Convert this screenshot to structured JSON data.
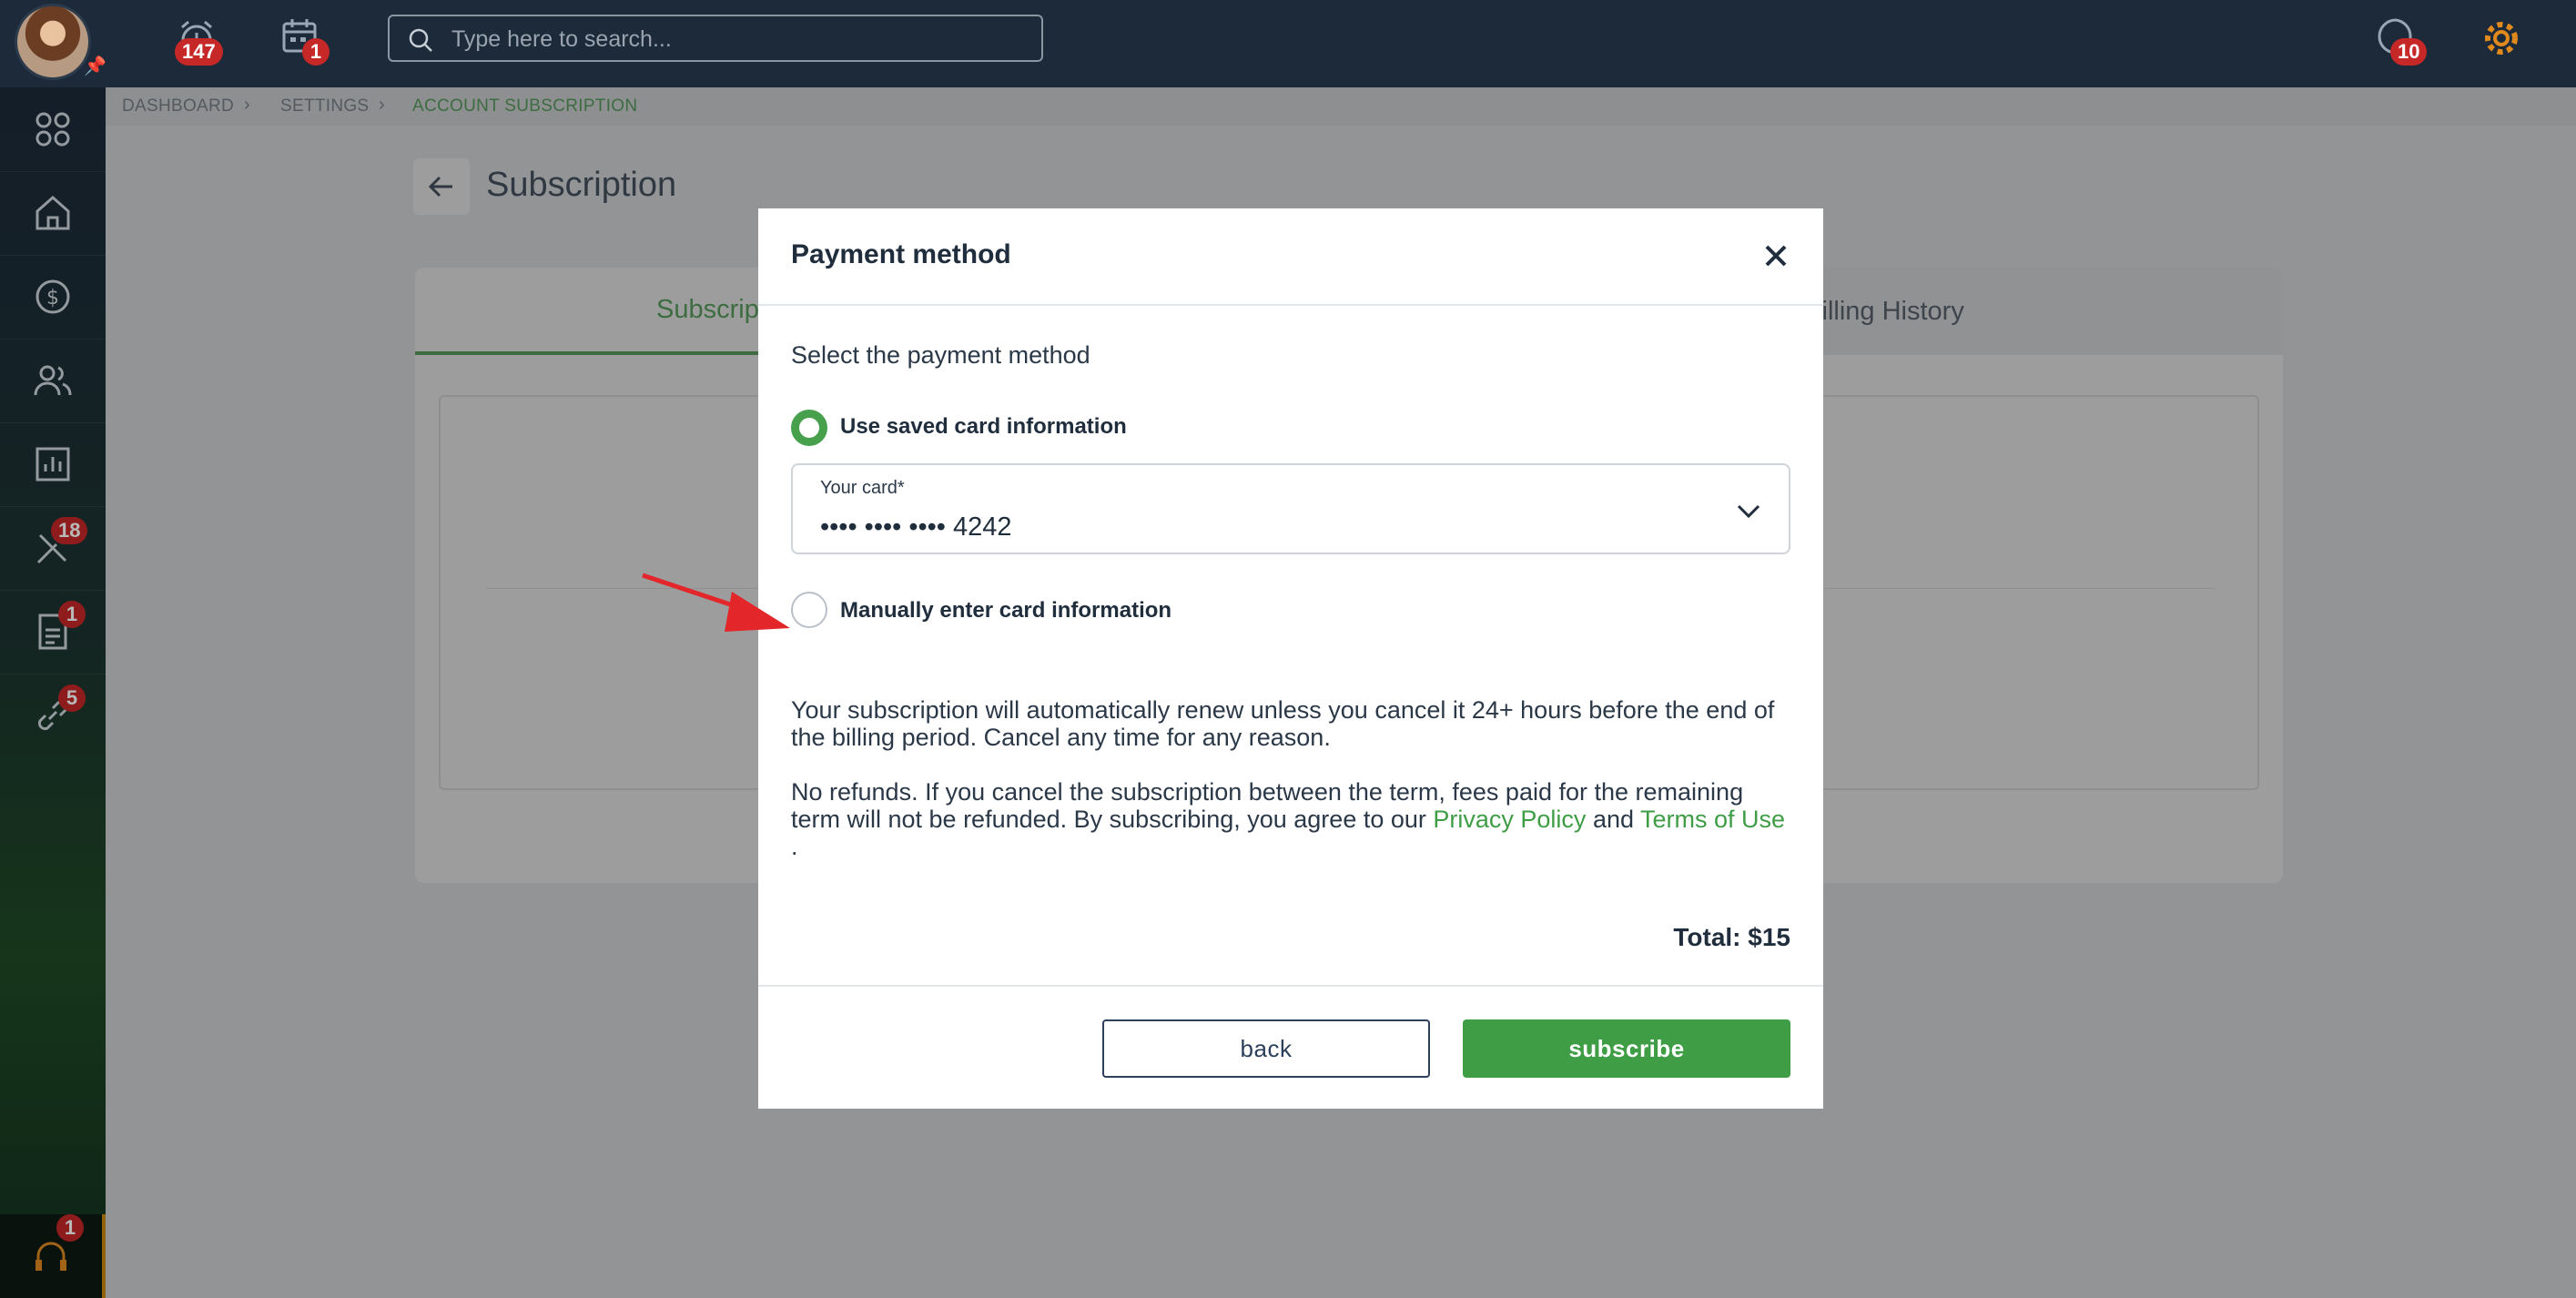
{
  "topbar": {
    "alarm_badge": "147",
    "calendar_badge": "1",
    "search_placeholder": "Type here to search...",
    "support_badge": "10"
  },
  "sidebar": {
    "tools_badge": "18",
    "docs_badge": "1",
    "links_badge": "5",
    "headset_badge": "1"
  },
  "breadcrumb": {
    "items": [
      "DASHBOARD",
      "SETTINGS",
      "ACCOUNT SUBSCRIPTION"
    ]
  },
  "page": {
    "title": "Subscription",
    "tabs": [
      "Subscrip",
      "Billing History"
    ]
  },
  "modal": {
    "title": "Payment method",
    "select_label": "Select the payment method",
    "option_saved": "Use saved card information",
    "card_field_label": "Your card*",
    "card_value": "•••• •••• •••• 4242",
    "option_manual": "Manually enter card information",
    "renew_text": "Your subscription will automatically renew unless you cancel it 24+ hours before the end of the billing period. Cancel any time for any reason.",
    "refund_text": "No refunds. If you cancel the subscription between the term, fees paid for the remaining term will not be refunded. By subscribing, you agree to our",
    "privacy_link": "Privacy Policy",
    "and_text": "and",
    "terms_link": "Terms of Use",
    "period": ".",
    "total": "Total: $15",
    "back_button": "back",
    "subscribe_button": "subscribe"
  },
  "colors": {
    "accent": "#3e9d45",
    "topbar": "#1c2a3a",
    "badge": "#c62828",
    "gear": "#e08a1e",
    "arrow": "#e3262a"
  }
}
